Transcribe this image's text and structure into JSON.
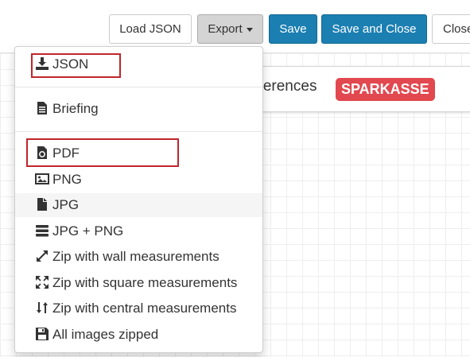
{
  "toolbar": {
    "load_json": "Load JSON",
    "export": "Export",
    "save": "Save",
    "save_close": "Save and Close",
    "close": "Close"
  },
  "card": {
    "title": "eferences",
    "badge": "SPARKASSE"
  },
  "menu": {
    "json": "JSON",
    "briefing": "Briefing",
    "pdf": "PDF",
    "png": "PNG",
    "jpg": "JPG",
    "jpg_png": "JPG + PNG",
    "zip_wall": "Zip with wall measurements",
    "zip_square": "Zip with square measurements",
    "zip_central": "Zip with central measurements",
    "all_images": "All images zipped"
  },
  "colors": {
    "primary": "#1b7fb2",
    "badge": "#e2484f",
    "highlight": "#c0262b"
  }
}
